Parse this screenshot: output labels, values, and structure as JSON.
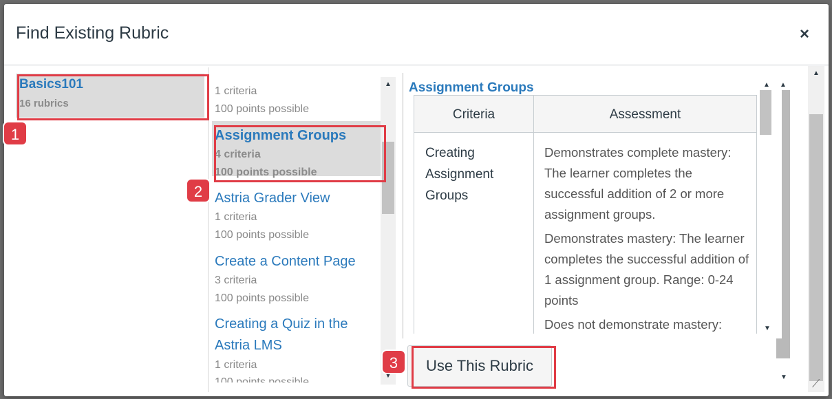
{
  "dialog": {
    "title": "Find Existing Rubric",
    "close_label": "×"
  },
  "groups": [
    {
      "name": "Basics101",
      "count": "16 rubrics"
    }
  ],
  "rubrics": [
    {
      "title": "",
      "criteria": "1 criteria",
      "points": "100 points possible"
    },
    {
      "title": "Assignment Groups",
      "criteria": "4 criteria",
      "points": "100 points possible"
    },
    {
      "title": "Astria Grader View",
      "criteria": "1 criteria",
      "points": "100 points possible"
    },
    {
      "title": "Create a Content Page",
      "criteria": "3 criteria",
      "points": "100 points possible"
    },
    {
      "title_line1": "Creating a Quiz in the",
      "title_line2": "Astria LMS",
      "criteria": "1 criteria",
      "points": "100 points possible"
    }
  ],
  "preview": {
    "title": "Assignment Groups",
    "headers": {
      "criteria": "Criteria",
      "assessment": "Assessment"
    },
    "criterion": "Creating Assignment Groups",
    "ratings": [
      "Demonstrates complete mastery: The learner completes the successful addition of 2 or more assignment groups.",
      "Demonstrates mastery: The learner completes the successful addition of 1 assignment group. Range: 0-24 points",
      "Does not demonstrate mastery:"
    ]
  },
  "use_button": "Use This Rubric",
  "badges": [
    "1",
    "2",
    "3"
  ],
  "colors": {
    "link": "#2b7abc",
    "highlight": "#e03c46",
    "selected_bg": "#dcdcdc"
  }
}
